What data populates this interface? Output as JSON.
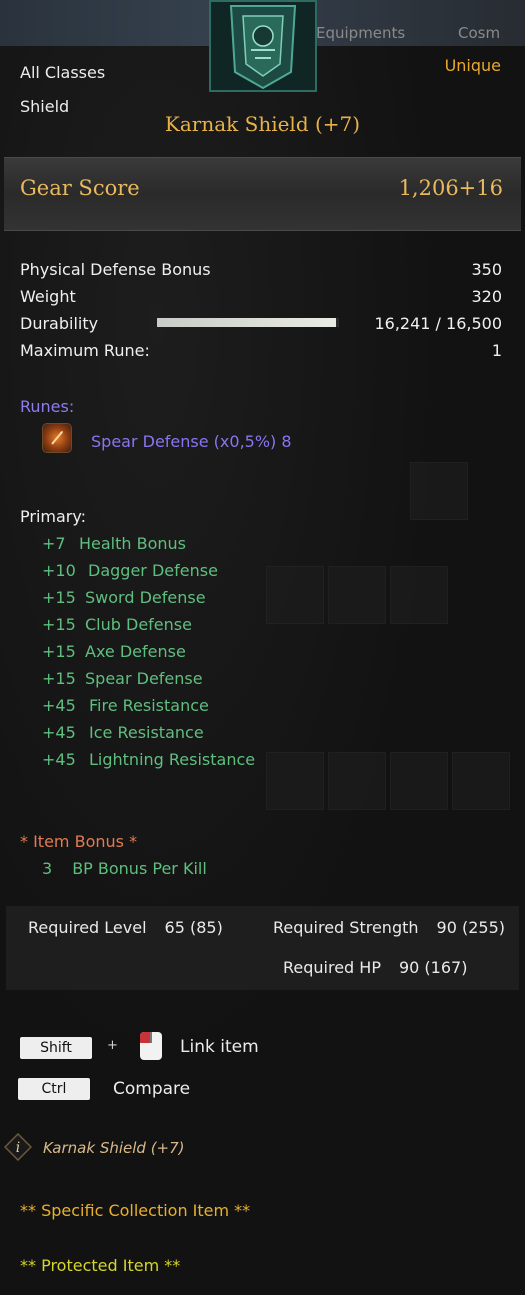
{
  "header": {
    "class_restriction": "All Classes",
    "item_type": "Shield",
    "grade": "Unique",
    "item_name": "Karnak Shield (+7)",
    "grade_color": "#e9a82e"
  },
  "background": {
    "tab_equipments": "Equipments",
    "tab_cosmetics": "Cosm"
  },
  "gear_score": {
    "label": "Gear Score",
    "value": "1,206+16"
  },
  "stats": {
    "physical_defense_label": "Physical Defense Bonus",
    "physical_defense_value": "350",
    "weight_label": "Weight",
    "weight_value": "320",
    "durability_label": "Durability",
    "durability_value": "16,241 / 16,500",
    "durability_fraction": 0.984,
    "max_rune_label": "Maximum Rune:",
    "max_rune_value": "1"
  },
  "runes": {
    "title": "Runes:",
    "items": [
      {
        "icon": "spear-rune-icon",
        "text": "Spear Defense (x0,5%) 8"
      }
    ]
  },
  "primary": {
    "title": "Primary:",
    "items": [
      {
        "amount": "+7",
        "name": "Health Bonus"
      },
      {
        "amount": "+10",
        "name": "Dagger Defense"
      },
      {
        "amount": "+15",
        "name": "Sword Defense"
      },
      {
        "amount": "+15",
        "name": "Club Defense"
      },
      {
        "amount": "+15",
        "name": "Axe Defense"
      },
      {
        "amount": "+15",
        "name": "Spear Defense"
      },
      {
        "amount": "+45",
        "name": "Fire Resistance"
      },
      {
        "amount": "+45",
        "name": "Ice Resistance"
      },
      {
        "amount": "+45",
        "name": "Lightning Resistance"
      }
    ]
  },
  "item_bonus": {
    "title": "*  Item Bonus *",
    "amount": "3",
    "name": "BP Bonus Per Kill"
  },
  "requirements": {
    "level_label": "Required Level",
    "level_value": "65 (85)",
    "strength_label": "Required Strength",
    "strength_value": "90 (255)",
    "hp_label": "Required HP",
    "hp_value": "90 (167)"
  },
  "hints": {
    "shift_key": "Shift",
    "plus": "+",
    "link_label": "Link item",
    "ctrl_key": "Ctrl",
    "compare_label": "Compare"
  },
  "footer": {
    "info_name": "Karnak Shield (+7)",
    "collection": "** Specific Collection Item **",
    "protected": "** Protected Item **"
  }
}
